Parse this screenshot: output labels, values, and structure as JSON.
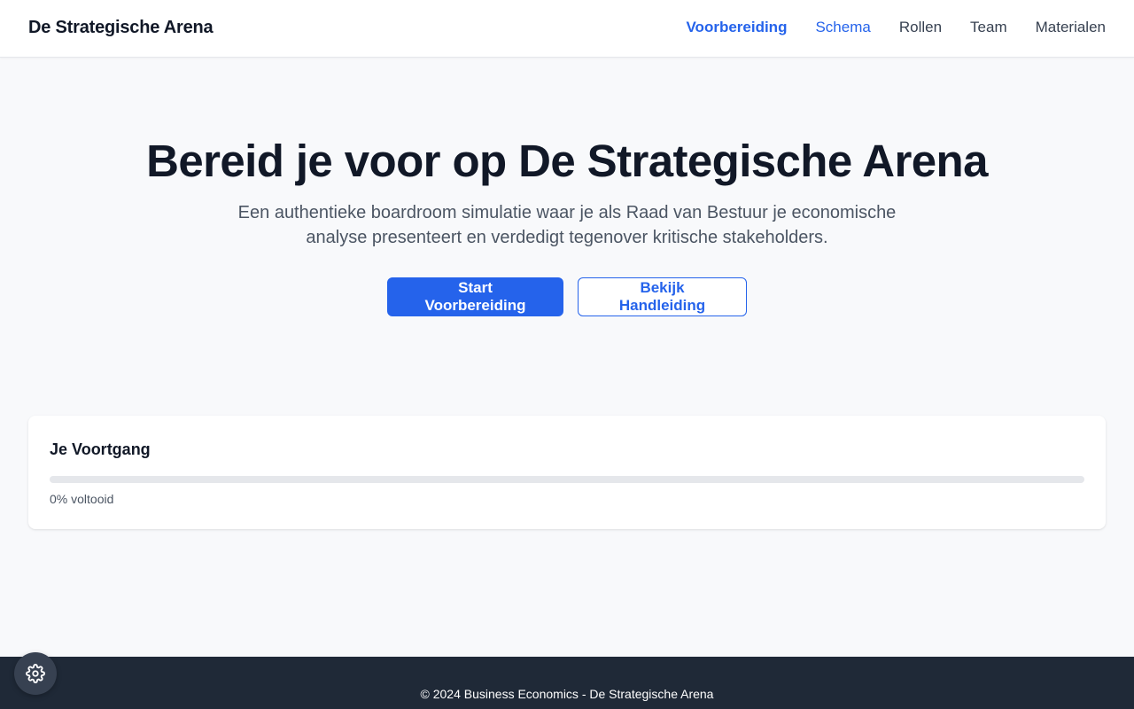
{
  "header": {
    "brand": "De Strategische Arena",
    "nav": [
      {
        "label": "Voorbereiding",
        "state": "active"
      },
      {
        "label": "Schema",
        "state": "hover"
      },
      {
        "label": "Rollen",
        "state": "normal"
      },
      {
        "label": "Team",
        "state": "normal"
      },
      {
        "label": "Materialen",
        "state": "normal"
      }
    ]
  },
  "hero": {
    "title": "Bereid je voor op De Strategische Arena",
    "subtitle": "Een authentieke boardroom simulatie waar je als Raad van Bestuur je economische analyse presenteert en verdedigt tegenover kritische stakeholders.",
    "primary_button": "Start Voorbereiding",
    "secondary_button": "Bekijk Handleiding"
  },
  "progress": {
    "title": "Je Voortgang",
    "value_percent": 0,
    "label": "0% voltooid"
  },
  "footer": {
    "text": "© 2024 Business Economics - De Strategische Arena"
  },
  "settings": {
    "icon": "gear-icon"
  },
  "colors": {
    "accent": "#2563eb",
    "footer_bg": "#1f2937",
    "page_bg": "#f8f9fb"
  }
}
